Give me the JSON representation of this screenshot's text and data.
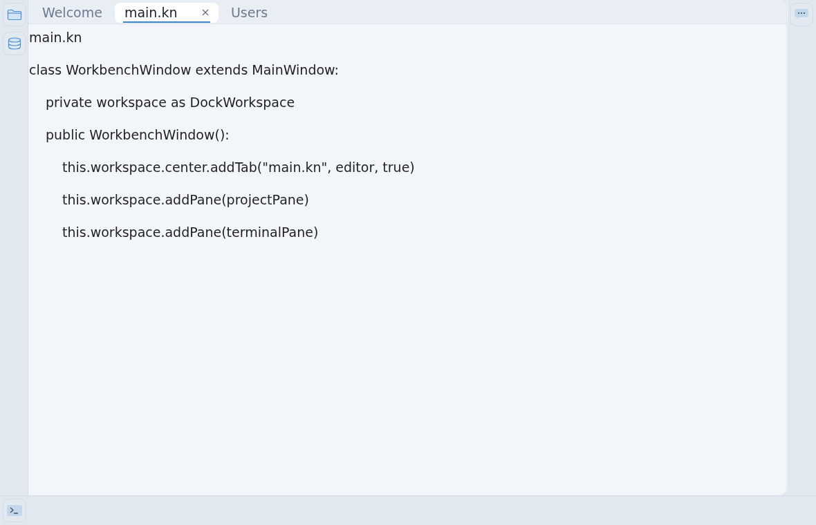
{
  "tabs": [
    {
      "label": "Welcome",
      "selected": false
    },
    {
      "label": "main.kn",
      "selected": true
    },
    {
      "label": "Users",
      "selected": false
    }
  ],
  "editor": {
    "lines": [
      {
        "text": "main.kn"
      },
      {
        "text": "class WorkbenchWindow extends MainWindow:",
        "children": [
          {
            "text": "private workspace as DockWorkspace"
          },
          {
            "text": "public WorkbenchWindow():",
            "children": [
              {
                "text": "this.workspace.center.addTab(\"main.kn\", editor, true)"
              },
              {
                "text": "this.workspace.addPane(projectPane)"
              },
              {
                "text": "this.workspace.addPane(terminalPane)"
              }
            ]
          }
        ]
      }
    ]
  }
}
